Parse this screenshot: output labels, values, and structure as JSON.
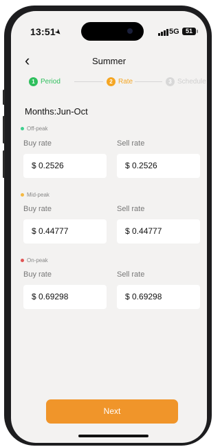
{
  "status_bar": {
    "time": "13:51",
    "network": "5G",
    "battery": "51",
    "location_icon": "location-arrow-icon"
  },
  "header": {
    "back_icon": "chevron-left-icon",
    "title": "Summer"
  },
  "stepper": {
    "steps": [
      {
        "number": "1",
        "label": "Period",
        "color": "#2fbf5d",
        "state": "done"
      },
      {
        "number": "2",
        "label": "Rate",
        "color": "#f5a623",
        "state": "active"
      },
      {
        "number": "3",
        "label": "Schedule",
        "color": "#d8d8d8",
        "state": "pending"
      }
    ]
  },
  "months_label": "Months:Jun-Oct",
  "sections": [
    {
      "label": "Off-peak",
      "dot_color": "#3ecf8e",
      "buy_label": "Buy rate",
      "sell_label": "Sell rate",
      "buy_value": "$ 0.2526",
      "sell_value": "$ 0.2526"
    },
    {
      "label": "Mid-peak",
      "dot_color": "#f5b942",
      "buy_label": "Buy rate",
      "sell_label": "Sell rate",
      "buy_value": "$ 0.44777",
      "sell_value": "$ 0.44777"
    },
    {
      "label": "On-peak",
      "dot_color": "#e05454",
      "buy_label": "Buy rate",
      "sell_label": "Sell rate",
      "buy_value": "$ 0.69298",
      "sell_value": "$ 0.69298"
    }
  ],
  "actions": {
    "next_label": "Next",
    "next_color": "#f0952a"
  }
}
